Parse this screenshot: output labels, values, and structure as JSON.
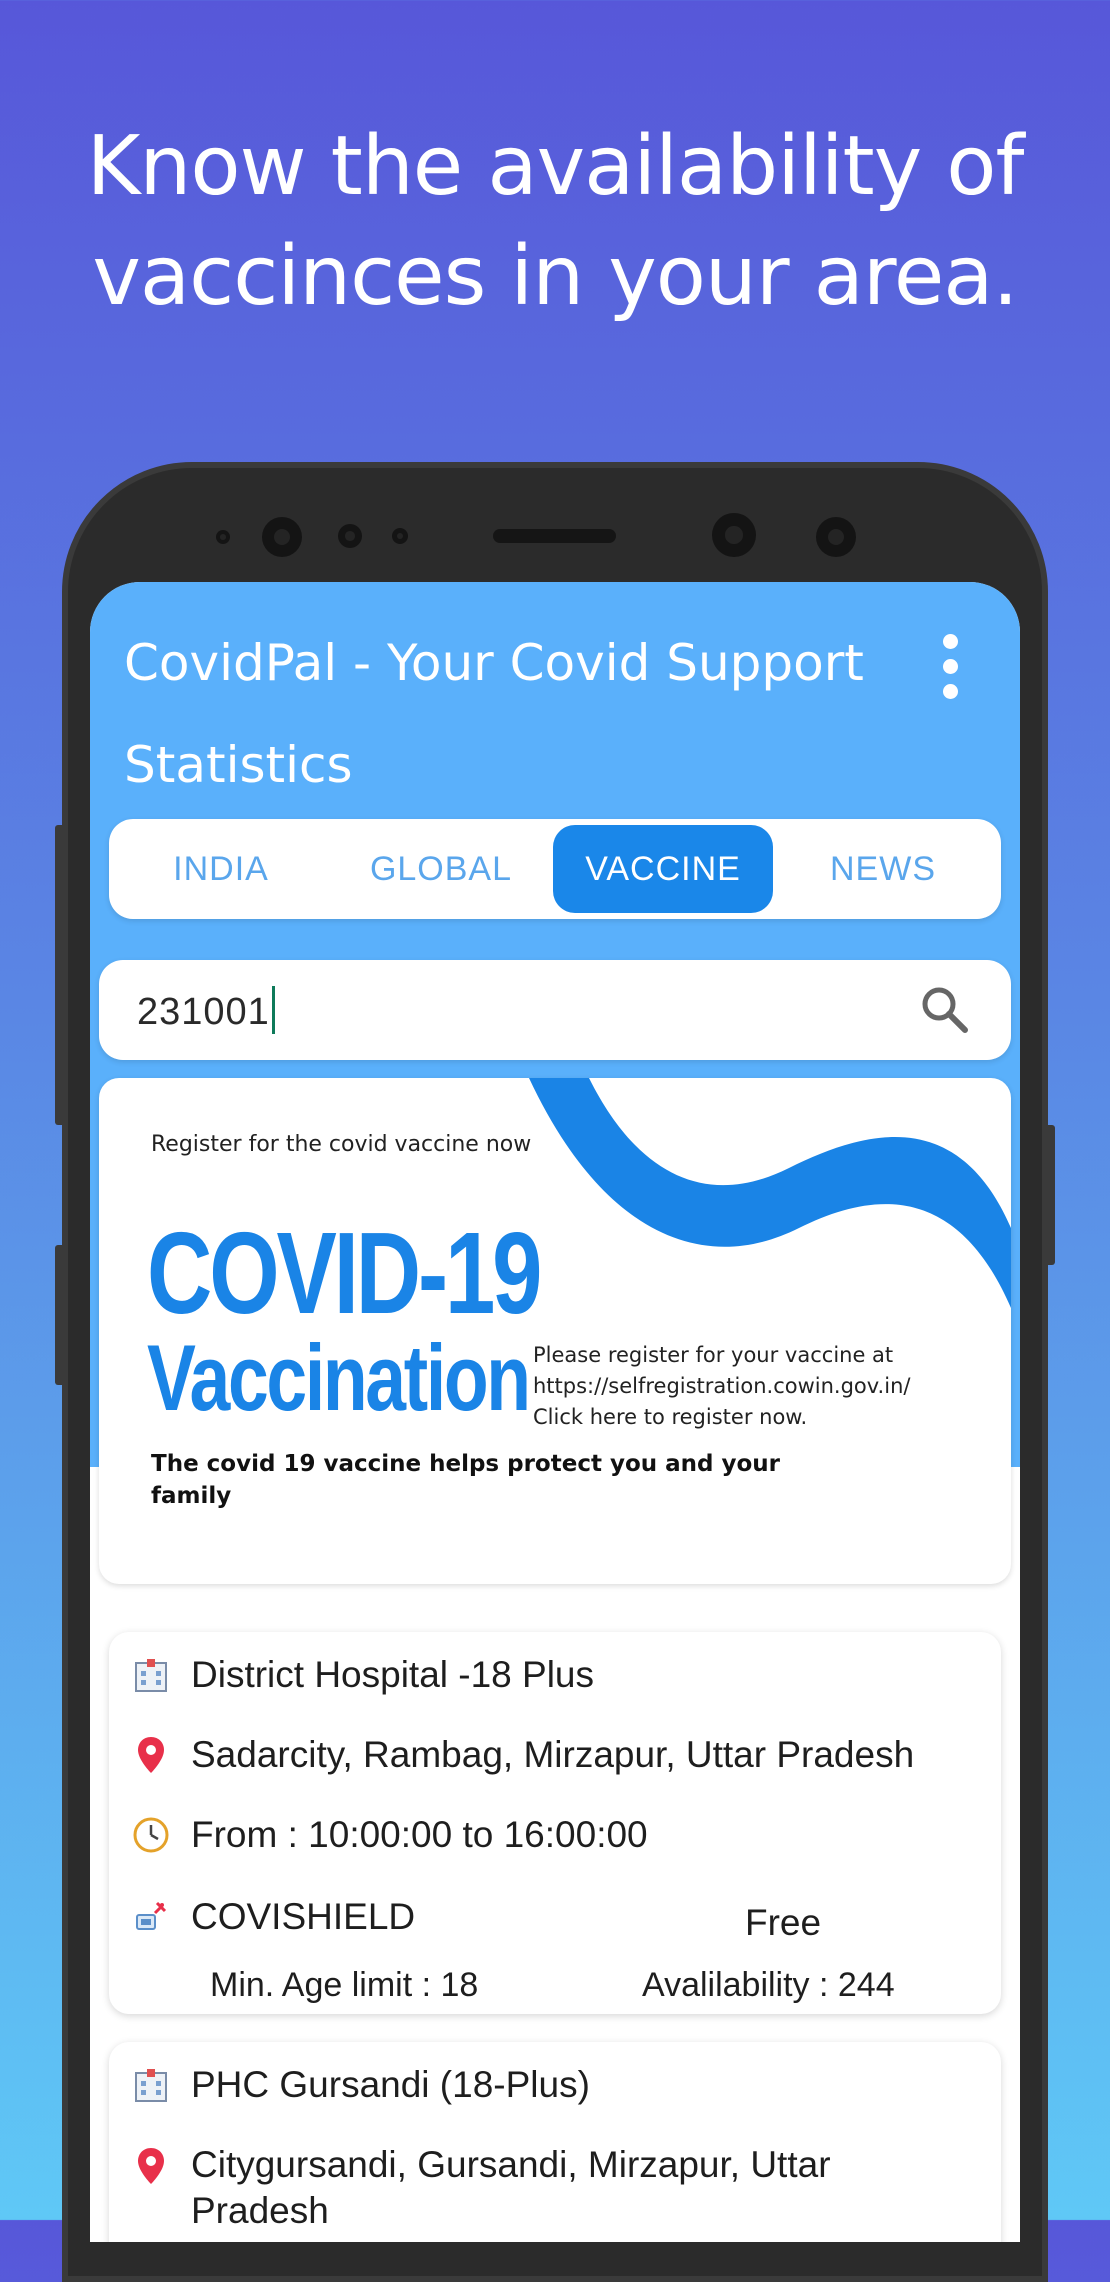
{
  "headline": {
    "line1": "Know the availability of",
    "line2": "vaccinces in your area."
  },
  "app": {
    "title": "CovidPal - Your Covid Support Statistics",
    "menu_icon": "more-vert-icon"
  },
  "tabs": [
    {
      "label": "INDIA",
      "active": false
    },
    {
      "label": "GLOBAL",
      "active": false
    },
    {
      "label": "VACCINE",
      "active": true
    },
    {
      "label": "NEWS",
      "active": false
    }
  ],
  "search": {
    "value": "231001",
    "icon": "search-icon"
  },
  "banner": {
    "register_line": "Register for the covid vaccine now",
    "title_line1": "COVID-19",
    "title_line2": "Vaccination",
    "please_line1": "Please register for your vaccine at",
    "please_line2": "https://selfregistration.cowin.gov.in/",
    "please_line3": "Click here to register now.",
    "protect_text": "The covid 19 vaccine helps protect you and your family",
    "accent_color": "#1a84e6"
  },
  "centers": [
    {
      "name": "District Hospital -18 Plus",
      "address": "Sadarcity, Rambag, Mirzapur, Uttar Pradesh",
      "timing": "From : 10:00:00 to 16:00:00",
      "vaccine": "COVISHIELD",
      "fee": "Free",
      "min_age": "Min. Age limit : 18",
      "availability": "Avalilability : 244"
    },
    {
      "name": "PHC Gursandi (18-Plus)",
      "address": "Citygursandi, Gursandi, Mirzapur, Uttar Pradesh"
    }
  ],
  "colors": {
    "appbar": "#5ab0fb",
    "active_tab": "#1a87e9",
    "tab_text": "#5aa6ec"
  }
}
